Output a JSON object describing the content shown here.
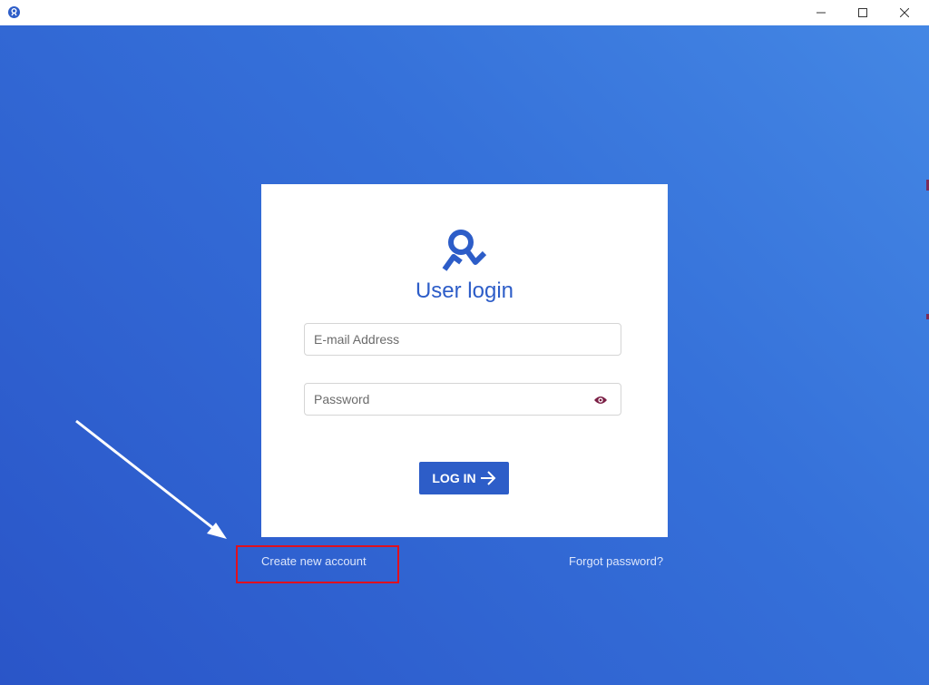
{
  "window": {
    "app_icon": "user-logo-icon",
    "controls": {
      "minimize": "minimize-icon",
      "maximize": "maximize-icon",
      "close": "close-icon"
    }
  },
  "login": {
    "logo_icon": "user-logo-icon",
    "title": "User login",
    "email": {
      "placeholder": "E-mail Address",
      "value": ""
    },
    "password": {
      "placeholder": "Password",
      "value": "",
      "toggle_icon": "eye-icon"
    },
    "submit_label": "LOG IN",
    "submit_icon": "arrow-right-icon"
  },
  "links": {
    "create_account": "Create new account",
    "forgot_password": "Forgot password?"
  },
  "annotation": {
    "highlight_color": "#e0101e",
    "arrow_color": "#ffffff"
  },
  "colors": {
    "brand": "#2d5dc8",
    "background_start": "#2a55c8",
    "background_end": "#4487e4"
  }
}
